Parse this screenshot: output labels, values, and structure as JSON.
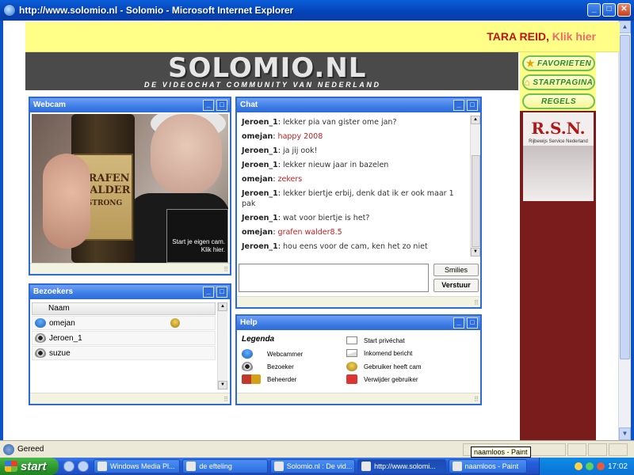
{
  "window": {
    "title": "http://www.solomio.nl - Solomio - Microsoft Internet Explorer"
  },
  "banner": {
    "ad_name": "TARA REID,",
    "ad_link": "Klik hier"
  },
  "site": {
    "logo": "SOLOMIO.NL",
    "tagline": "DE VIDEOCHAT COMMUNITY VAN NEDERLAND"
  },
  "nav": {
    "favorites": "FAVORIETEN",
    "homepage": "STARTPAGINA",
    "rules": "REGELS"
  },
  "rsn": {
    "logo": "R.S.N.",
    "sub": "Rijbewijs Service Nederland"
  },
  "webcam": {
    "title": "Webcam",
    "label_text": "GRAFEN WALDER",
    "label_sub": "STRONG",
    "overlay_line1": "Start je eigen cam.",
    "overlay_line2": "Klik hier."
  },
  "chat": {
    "title": "Chat",
    "messages": [
      {
        "user": "Jeroen_1",
        "text": "lekker pia van gister ome jan?",
        "red": false
      },
      {
        "user": "omejan",
        "text": "happy 2008",
        "red": true
      },
      {
        "user": "Jeroen_1",
        "text": "ja jij ook!",
        "red": false
      },
      {
        "user": "Jeroen_1",
        "text": "lekker nieuw jaar in bazelen",
        "red": false
      },
      {
        "user": "omejan",
        "text": "zekers",
        "red": true
      },
      {
        "user": "Jeroen_1",
        "text": "lekker biertje erbij, denk dat ik er ook maar 1 pak",
        "red": false
      },
      {
        "user": "Jeroen_1",
        "text": "wat voor biertje is het?",
        "red": false
      },
      {
        "user": "omejan",
        "text": "grafen walder8.5",
        "red": true
      },
      {
        "user": "Jeroen_1",
        "text": "hou eens voor de cam, ken het zo niet",
        "red": false
      }
    ],
    "input_value": "",
    "smilies_label": "Smilies",
    "send_label": "Verstuur"
  },
  "visitors": {
    "title": "Bezoekers",
    "column": "Naam",
    "rows": [
      {
        "name": "omejan",
        "icon": "webcam-user-icon",
        "has_cam": true
      },
      {
        "name": "Jeroen_1",
        "icon": "visitor-icon",
        "has_cam": false
      },
      {
        "name": "suzue",
        "icon": "visitor-icon",
        "has_cam": false
      }
    ]
  },
  "help": {
    "title": "Help",
    "legend_title": "Legenda",
    "items": [
      {
        "label": "Webcammer",
        "icon": "webcammer-icon"
      },
      {
        "label": "Bezoeker",
        "icon": "visitor-icon"
      },
      {
        "label": "Beheerder",
        "icon": "admin-icon"
      },
      {
        "label": "Start privéchat",
        "icon": "envelope-icon"
      },
      {
        "label": "Inkomend bericht",
        "icon": "open-envelope-icon"
      },
      {
        "label": "Gebruiker heeft cam",
        "icon": "cam-icon"
      },
      {
        "label": "Verwijder gebruiker",
        "icon": "remove-user-icon"
      }
    ]
  },
  "status": {
    "text": "Gereed",
    "tooltip": "naamloos - Paint"
  },
  "taskbar": {
    "start": "start",
    "tasks": [
      {
        "label": "Windows Media Pl...",
        "active": false
      },
      {
        "label": "de efteling",
        "active": false
      },
      {
        "label": "Solomio.nl : De vid...",
        "active": false
      },
      {
        "label": "http://www.solomi...",
        "active": true
      },
      {
        "label": "naamloos - Paint",
        "active": false
      }
    ],
    "clock": "17:02"
  },
  "colors": {
    "accent": "#2c6ad6",
    "banner_bg": "#ffff88",
    "header_bg": "#4a4a4a",
    "sidebar_bg": "#7a1c1c",
    "red_text": "#c21e1e"
  }
}
